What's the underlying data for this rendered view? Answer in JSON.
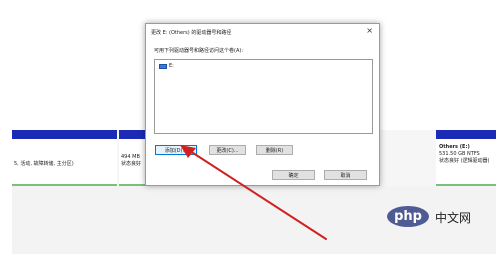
{
  "dialog": {
    "title": "更改 E: (Others) 的驱动器号和路径",
    "close_glyph": "×",
    "prompt": "可用下列驱动器号和路径访问这个卷(A):",
    "list_items": [
      "E:"
    ],
    "buttons": {
      "add": "添加(D)...",
      "change": "更改(C)...",
      "delete": "删除(R)",
      "ok": "确定",
      "cancel": "取消"
    }
  },
  "disk_strip": {
    "left_segment_text": "5, 活动, 故障转储, 主分区)",
    "mid_segment": {
      "size": "494 MB",
      "status": "状态良好"
    },
    "right_segment": {
      "name": "Others (E:)",
      "size": "531.50 GB NTFS",
      "status": "状态良好 (逻辑驱动器)"
    }
  },
  "watermark": {
    "logo_text": "php",
    "site_text": "中文网"
  },
  "colors": {
    "partition_bar": "#1b2bb5",
    "healthy_bar": "#7cbf7a",
    "arrow": "#d02020",
    "accent": "#0078d7"
  }
}
